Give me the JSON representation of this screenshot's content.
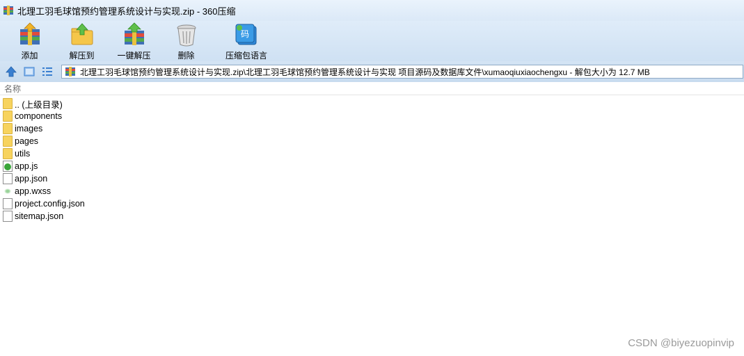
{
  "window": {
    "title": "北理工羽毛球馆预约管理系统设计与实现.zip - 360压缩"
  },
  "toolbar": {
    "buttons": [
      {
        "label": "添加",
        "icon": "add-archive-icon"
      },
      {
        "label": "解压到",
        "icon": "extract-to-icon"
      },
      {
        "label": "一键解压",
        "icon": "one-click-extract-icon"
      },
      {
        "label": "删除",
        "icon": "delete-icon"
      },
      {
        "label": "压缩包语言",
        "icon": "archive-language-icon"
      }
    ]
  },
  "address": {
    "path": "北理工羽毛球馆预约管理系统设计与实现.zip\\北理工羽毛球馆预约管理系统设计与实现 项目源码及数据库文件\\xumaoqiuxiaochengxu - 解包大小为 12.7 MB"
  },
  "list": {
    "column_name": "名称",
    "items": [
      {
        "name": ".. (上级目录)",
        "type": "folder"
      },
      {
        "name": "components",
        "type": "folder"
      },
      {
        "name": "images",
        "type": "folder"
      },
      {
        "name": "pages",
        "type": "folder"
      },
      {
        "name": "utils",
        "type": "folder"
      },
      {
        "name": "app.js",
        "type": "js"
      },
      {
        "name": "app.json",
        "type": "file"
      },
      {
        "name": "app.wxss",
        "type": "wxss"
      },
      {
        "name": "project.config.json",
        "type": "file"
      },
      {
        "name": "sitemap.json",
        "type": "file"
      }
    ]
  },
  "watermark": "CSDN @biyezuopinvip",
  "colors": {
    "toolbar_bg": "#d8e7f6",
    "folder": "#f7d35e",
    "nav_blue": "#3a7fd0"
  }
}
